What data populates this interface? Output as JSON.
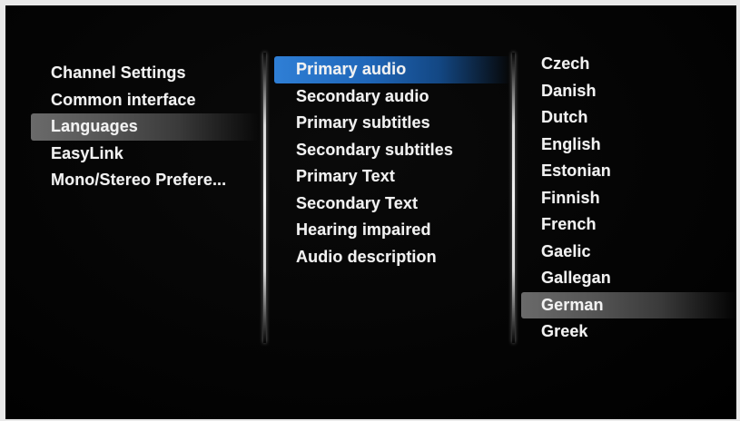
{
  "left_menu": {
    "items": [
      {
        "label": "Channel Settings"
      },
      {
        "label": "Common interface"
      },
      {
        "label": "Languages"
      },
      {
        "label": "EasyLink"
      },
      {
        "label": "Mono/Stereo Prefere..."
      }
    ],
    "selected_index": 2
  },
  "middle_menu": {
    "items": [
      {
        "label": "Primary audio"
      },
      {
        "label": "Secondary audio"
      },
      {
        "label": "Primary subtitles"
      },
      {
        "label": "Secondary subtitles"
      },
      {
        "label": "Primary Text"
      },
      {
        "label": "Secondary Text"
      },
      {
        "label": "Hearing impaired"
      },
      {
        "label": "Audio description"
      }
    ],
    "focused_index": 0
  },
  "right_menu": {
    "items": [
      {
        "label": "Czech"
      },
      {
        "label": "Danish"
      },
      {
        "label": "Dutch"
      },
      {
        "label": "English"
      },
      {
        "label": "Estonian"
      },
      {
        "label": "Finnish"
      },
      {
        "label": "French"
      },
      {
        "label": "Gaelic"
      },
      {
        "label": "Gallegan"
      },
      {
        "label": "German"
      },
      {
        "label": "Greek"
      }
    ],
    "selected_index": 9
  },
  "colors": {
    "focus_blue": "#2f7fd6",
    "selection_grey": "#6a6a6a",
    "background": "#000000",
    "text": "#f2f2f2"
  }
}
